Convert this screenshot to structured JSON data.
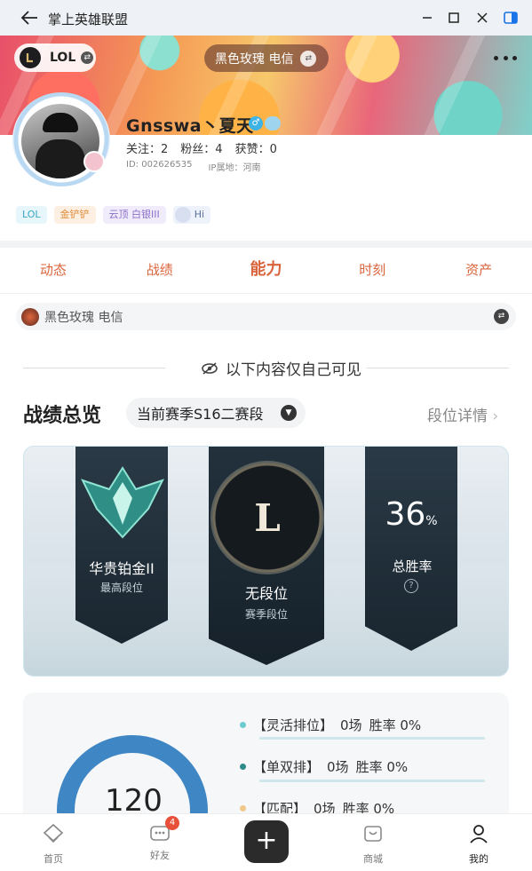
{
  "window": {
    "title": "掌上英雄联盟"
  },
  "header": {
    "game": "LOL",
    "server": "黑色玫瑰 电信"
  },
  "profile": {
    "username": "Gnsswa丶夏天",
    "follow_label": "关注：2",
    "fans_label": "粉丝：4",
    "likes_label": "获赞：0",
    "id_label": "ID:",
    "id_value": "002626535",
    "ip_label": "IP属地：河南",
    "tags": [
      "LOL",
      "金铲铲",
      "云顶 白银III",
      "Hi"
    ]
  },
  "tabs": [
    "动态",
    "战绩",
    "能力",
    "时刻",
    "资产"
  ],
  "active_tab": "能力",
  "server_bar": {
    "label": "黑色玫瑰 电信"
  },
  "privacy_notice": "以下内容仅自己可见",
  "overview": {
    "title": "战绩总览",
    "season": "当前赛季S16二赛段",
    "rank_detail": "段位详情"
  },
  "rank_card": {
    "highest_rank": "华贵铂金II",
    "highest_label": "最高段位",
    "season_rank": "无段位",
    "season_label": "赛季段位",
    "medal_letter": "L",
    "winrate_value": "36",
    "winrate_unit": "%",
    "winrate_label": "总胜率",
    "help_icon": "?"
  },
  "stats": {
    "total": "120",
    "modes": [
      {
        "name": "【灵活排位】",
        "games": "0场",
        "winrate": "胜率 0%",
        "color": "#6ccccf"
      },
      {
        "name": "【单双排】",
        "games": "0场",
        "winrate": "胜率 0%",
        "color": "#2f8a8a"
      },
      {
        "name": "【匹配】",
        "games": "0场",
        "winrate": "胜率 0%",
        "color": "#f0c98a"
      }
    ]
  },
  "bottom_nav": {
    "home": "首页",
    "friends": "好友",
    "friends_badge": "4",
    "plus": "+",
    "shop": "商城",
    "me": "我的"
  }
}
